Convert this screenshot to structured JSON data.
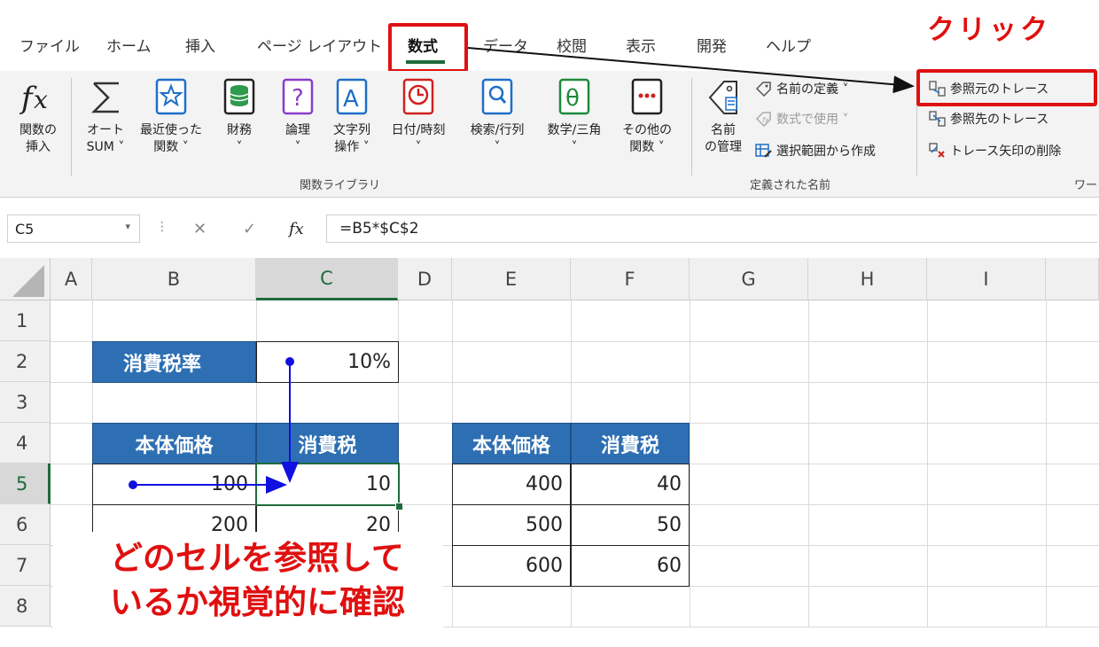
{
  "tabs": [
    {
      "label": "ファイル"
    },
    {
      "label": "ホーム"
    },
    {
      "label": "挿入"
    },
    {
      "label": "ページ レイアウト"
    },
    {
      "label": "数式"
    },
    {
      "label": "データ"
    },
    {
      "label": "校閲"
    },
    {
      "label": "表示"
    },
    {
      "label": "開発"
    },
    {
      "label": "ヘルプ"
    }
  ],
  "annotations": {
    "click_label": "クリック",
    "callout_line1": "どのセルを参照して",
    "callout_line2": "いるか視覚的に確認",
    "highlight_color": "#e01010"
  },
  "ribbon": {
    "function_library": {
      "group_label": "関数ライブラリ",
      "buttons": [
        {
          "line1": "関数の",
          "line2": "挿入",
          "icon": "fx-icon"
        },
        {
          "line1": "オート",
          "line2": "SUM ˅",
          "icon": "sigma-icon"
        },
        {
          "line1": "最近使った",
          "line2": "関数 ˅",
          "icon": "star-book-icon"
        },
        {
          "line1": "財務",
          "line2": "˅",
          "icon": "coins-book-icon"
        },
        {
          "line1": "論理",
          "line2": "˅",
          "icon": "question-book-icon"
        },
        {
          "line1": "文字列",
          "line2": "操作 ˅",
          "icon": "letter-book-icon"
        },
        {
          "line1": "日付/時刻",
          "line2": "˅",
          "icon": "clock-book-icon"
        },
        {
          "line1": "検索/行列",
          "line2": "˅",
          "icon": "magnifier-book-icon"
        },
        {
          "line1": "数学/三角",
          "line2": "˅",
          "icon": "theta-book-icon"
        },
        {
          "line1": "その他の",
          "line2": "関数 ˅",
          "icon": "more-book-icon"
        }
      ]
    },
    "defined_names": {
      "group_label": "定義された名前",
      "name_manager_line1": "名前",
      "name_manager_line2": "の管理",
      "define_name": "名前の定義 ˅",
      "use_in_formula": "数式で使用 ˅",
      "create_from_selection": "選択範囲から作成"
    },
    "auditing": {
      "group_label": "ワー",
      "trace_precedents": "参照元のトレース",
      "trace_dependents": "参照先のトレース",
      "remove_arrows": "トレース矢印の削除"
    }
  },
  "formula_bar": {
    "name_box": "C5",
    "cancel": "✕",
    "enter": "✓",
    "fx": "fx",
    "formula": "=B5*$C$2"
  },
  "sheet": {
    "columns": [
      "A",
      "B",
      "C",
      "D",
      "E",
      "F",
      "G",
      "H",
      "I"
    ],
    "rows": [
      "1",
      "2",
      "3",
      "4",
      "5",
      "6",
      "7",
      "8"
    ],
    "selected_cell": "C5",
    "tax_rate_label": "消費税率",
    "tax_rate_value": "10%",
    "table1": {
      "headers": [
        "本体価格",
        "消費税"
      ],
      "rows": [
        [
          "100",
          "10"
        ],
        [
          "200",
          "20"
        ]
      ]
    },
    "table2": {
      "headers": [
        "本体価格",
        "消費税"
      ],
      "rows": [
        [
          "400",
          "40"
        ],
        [
          "500",
          "50"
        ],
        [
          "600",
          "60"
        ]
      ]
    },
    "trace_arrow_color": "#1010e0"
  }
}
